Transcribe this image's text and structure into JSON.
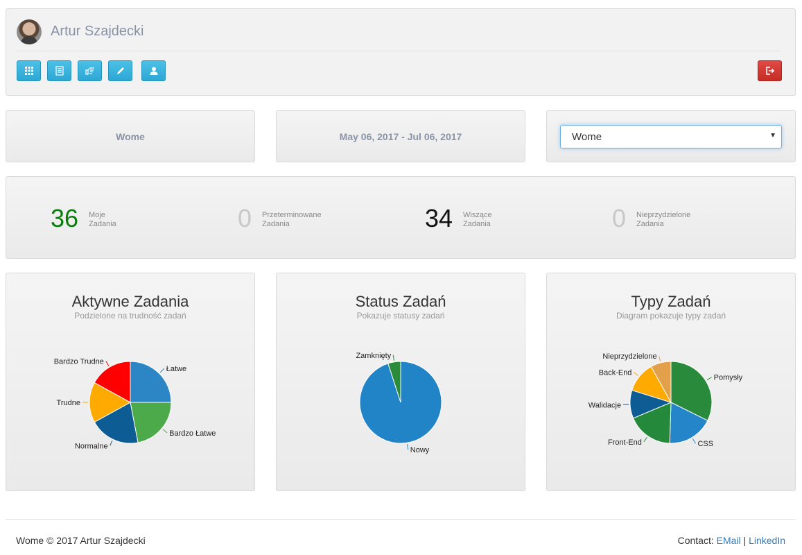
{
  "header": {
    "user_name": "Artur Szajdecki",
    "toolbar": [
      {
        "name": "dashboard-button",
        "icon": "grid-icon"
      },
      {
        "name": "tasks-list-button",
        "icon": "list-icon"
      },
      {
        "name": "assign-button",
        "icon": "hand-pointing-icon"
      },
      {
        "name": "edit-button",
        "icon": "pencil-icon"
      },
      {
        "name": "profile-button",
        "icon": "user-icon"
      }
    ],
    "logout_icon": "logout-icon"
  },
  "filters": {
    "project_label": "Wome",
    "date_range": "May 06, 2017 - Jul 06, 2017",
    "project_select_value": "Wome"
  },
  "stats": [
    {
      "value": "36",
      "line1": "Moje",
      "line2": "Zadania",
      "color": "#0a7e0a"
    },
    {
      "value": "0",
      "line1": "Przeterminowane",
      "line2": "Zadania",
      "color": "#c8c8c8"
    },
    {
      "value": "34",
      "line1": "Wiszące",
      "line2": "Zadania",
      "color": "#111111"
    },
    {
      "value": "0",
      "line1": "Nieprzydzielone",
      "line2": "Zadania",
      "color": "#c8c8c8"
    }
  ],
  "charts": [
    {
      "title": "Aktywne Zadania",
      "subtitle": "Podzielone na trudność zadań"
    },
    {
      "title": "Status Zadań",
      "subtitle": "Pokazuje statusy zadań"
    },
    {
      "title": "Typy Zadań",
      "subtitle": "Diagram pokazuje typy zadań"
    }
  ],
  "chart_data": [
    {
      "type": "pie",
      "title": "Aktywne Zadania",
      "subtitle": "Podzielone na trudność zadań",
      "slices": [
        {
          "label": "Łatwe",
          "value": 25,
          "color": "#2c86c5"
        },
        {
          "label": "Bardzo Łatwe",
          "value": 22,
          "color": "#4daa4a"
        },
        {
          "label": "Normalne",
          "value": 20,
          "color": "#0e5c94"
        },
        {
          "label": "Trudne",
          "value": 16,
          "color": "#ffaa00"
        },
        {
          "label": "Bardzo Trudne",
          "value": 17,
          "color": "#ff0000"
        }
      ]
    },
    {
      "type": "pie",
      "title": "Status Zadań",
      "subtitle": "Pokazuje statusy zadań",
      "slices": [
        {
          "label": "Nowy",
          "value": 95,
          "color": "#2184c7"
        },
        {
          "label": "Zamknięty",
          "value": 5,
          "color": "#2a8c3a"
        }
      ]
    },
    {
      "type": "pie",
      "title": "Typy Zadań",
      "subtitle": "Diagram pokazuje typy zadań",
      "slices": [
        {
          "label": "Pomysły",
          "value": 32,
          "color": "#288a3a"
        },
        {
          "label": "CSS",
          "value": 18,
          "color": "#2485c8"
        },
        {
          "label": "Front-End",
          "value": 18,
          "color": "#24893a"
        },
        {
          "label": "Walidacje",
          "value": 11,
          "color": "#0e5c94"
        },
        {
          "label": "Back-End",
          "value": 12,
          "color": "#ffaa00"
        },
        {
          "label": "Nieprzydzielone",
          "value": 8,
          "color": "#e3a04a"
        }
      ]
    }
  ],
  "footer": {
    "copyright": "Wome © 2017 Artur Szajdecki",
    "contact_label": "Contact:",
    "email_link": "EMail",
    "separator": "|",
    "linkedin_link": "LinkedIn"
  }
}
